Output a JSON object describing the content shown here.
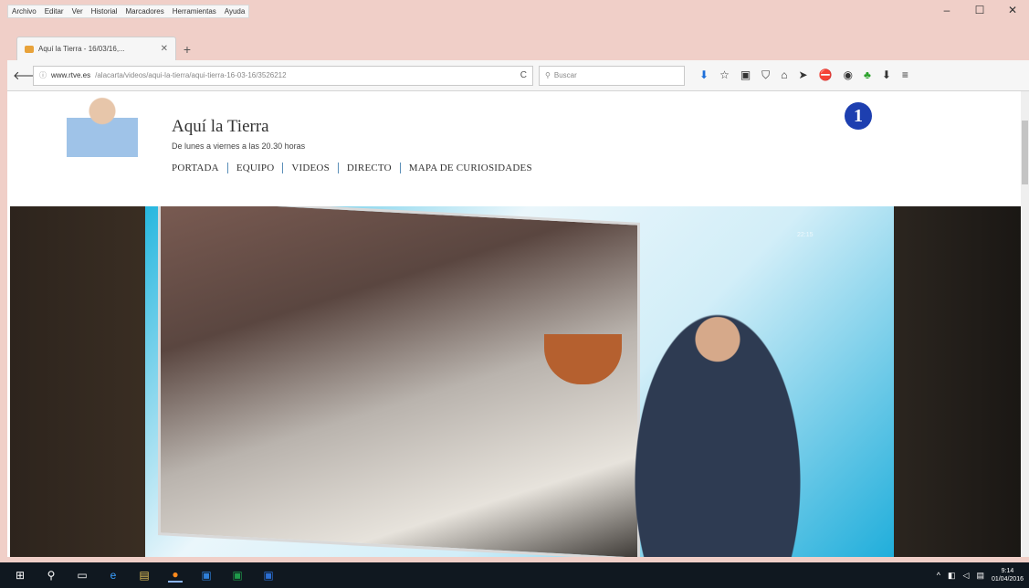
{
  "browser": {
    "menu": [
      "Archivo",
      "Editar",
      "Ver",
      "Historial",
      "Marcadores",
      "Herramientas",
      "Ayuda"
    ],
    "tab_title": "Aquí la Tierra - 16/03/16,...",
    "url_host": "www.rtve.es",
    "url_path": "/alacarta/videos/aqui-la-tierra/aqui-tierra-16-03-16/3526212",
    "search_placeholder": "Buscar",
    "window_controls": {
      "minimize": "–",
      "maximize": "☐",
      "close": "✕"
    }
  },
  "site": {
    "title": "Aquí la Tierra",
    "subtitle": "De lunes a viernes a las 20.30 horas",
    "nav": [
      "PORTADA",
      "EQUIPO",
      "VIDEOS",
      "DIRECTO",
      "MAPA DE CURIOSIDADES"
    ],
    "channel_logo": "1"
  },
  "video": {
    "overlay_text": "22:15"
  },
  "taskbar": {
    "icons": [
      "windows-start-icon",
      "search-icon",
      "task-view-icon",
      "edge-icon",
      "file-explorer-icon",
      "firefox-icon",
      "outlook-icon",
      "excel-icon",
      "word-icon"
    ],
    "clock_time": "9:14",
    "clock_date": "01/04/2016"
  }
}
